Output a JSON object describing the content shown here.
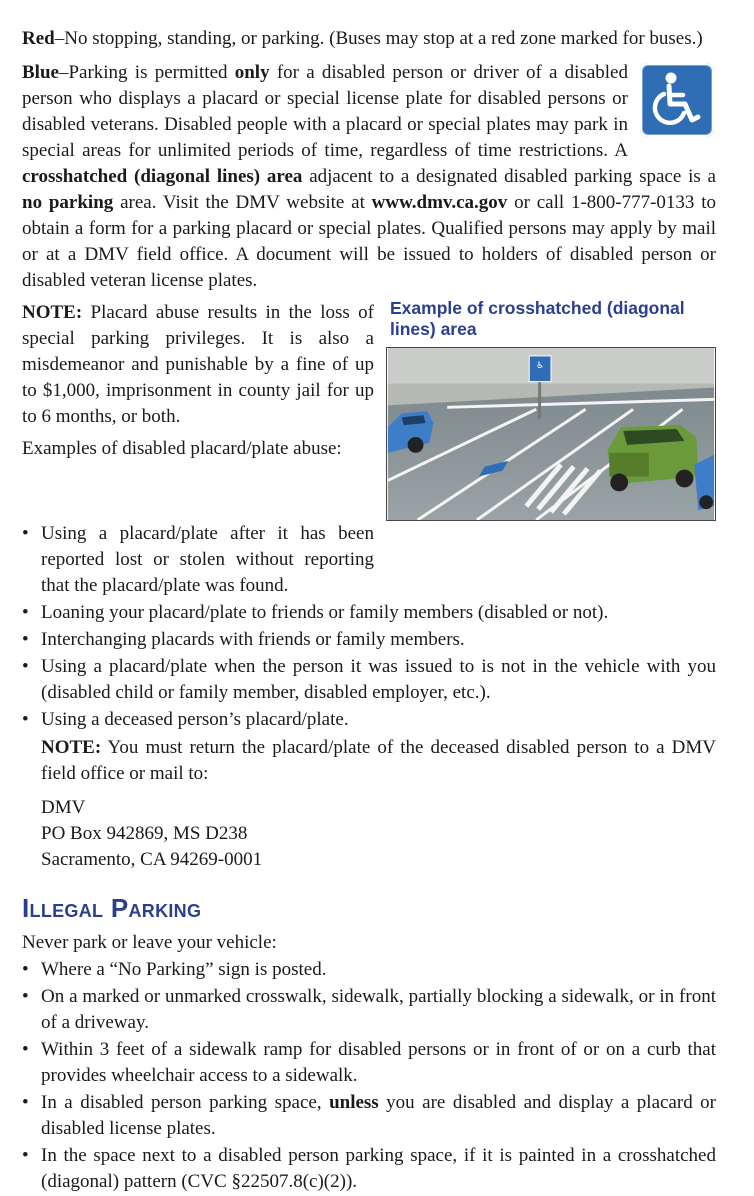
{
  "red": {
    "term": "Red",
    "text": "–No stopping, standing, or parking. (Buses may stop at a red zone marked for buses.)"
  },
  "blue": {
    "term": "Blue",
    "t1": "–Parking is permitted ",
    "b1": "only",
    "t2": " for a disabled person or driver of a disabled person who displays a placard or special license plate for disabled persons or disabled veterans. Disabled people with a placard or special plates may park in special areas for unlimited periods of time, regardless of time restrictions. A ",
    "b2": "crosshatched (diagonal lines) area",
    "t3": " adjacent to a designated disabled parking space is a ",
    "b3": "no parking",
    "t4": " area. Visit the DMV website at ",
    "b4": "www.dmv.ca.gov",
    "t5": " or call 1-800-777-0133 to obtain a form for a parking placard or special plates. Qualified persons may apply by mail or at a DMV field office. A document will be issued to holders of disabled person or disabled veteran license plates.",
    "icon": "wheelchair-accessibility-icon",
    "icon_color": "#2f6db5"
  },
  "note1": {
    "label": "NOTE:",
    "text": " Placard abuse results in the loss of special parking privileges. It is also a misdemeanor and punishable by a fine of up to $1,000, imprisonment in county jail for up to 6 months, or both."
  },
  "figure": {
    "caption": "Example of crosshatched (diagonal lines) area",
    "caption_color": "#2b3f8f"
  },
  "abuse_intro": "Examples of disabled placard/plate abuse:",
  "abuse_items": [
    "Using a placard/plate after it has been reported lost or stolen without reporting that the placard/plate was found.",
    "Loaning your placard/plate to friends or family members (disabled or not).",
    "Interchanging placards with friends or family members.",
    "Using a placard/plate when the person it was issued to is not in the vehicle with you (disabled child or family member, disabled employer, etc.).",
    "Using a deceased person’s placard/plate."
  ],
  "note2": {
    "label": "NOTE:",
    "text": " You must return the placard/plate of the deceased disabled person to a DMV field office or mail to:"
  },
  "address": [
    "DMV",
    "PO Box 942869, MS D238",
    "Sacramento, CA 94269-0001"
  ],
  "illegal": {
    "heading": "Illegal Parking",
    "intro": "Never park or leave your vehicle:",
    "items": [
      {
        "t1": "Where a “No Parking” sign is posted.",
        "b": "",
        "t2": ""
      },
      {
        "t1": "On a marked or unmarked crosswalk, sidewalk, partially blocking a sidewalk, or in front of a driveway.",
        "b": "",
        "t2": ""
      },
      {
        "t1": "Within 3 feet of a sidewalk ramp for disabled persons or in front of or on a curb that provides wheelchair access to a sidewalk.",
        "b": "",
        "t2": ""
      },
      {
        "t1": "In a disabled person parking space, ",
        "b": "unless",
        "t2": " you are disabled and display a placard or disabled license plates."
      },
      {
        "t1": "In the space next to a disabled person parking space, if it is painted in a crosshatched (diagonal) pattern (CVC §22507.8(c)(2)).",
        "b": "",
        "t2": ""
      }
    ],
    "heading_color": "#2b3f8f"
  }
}
